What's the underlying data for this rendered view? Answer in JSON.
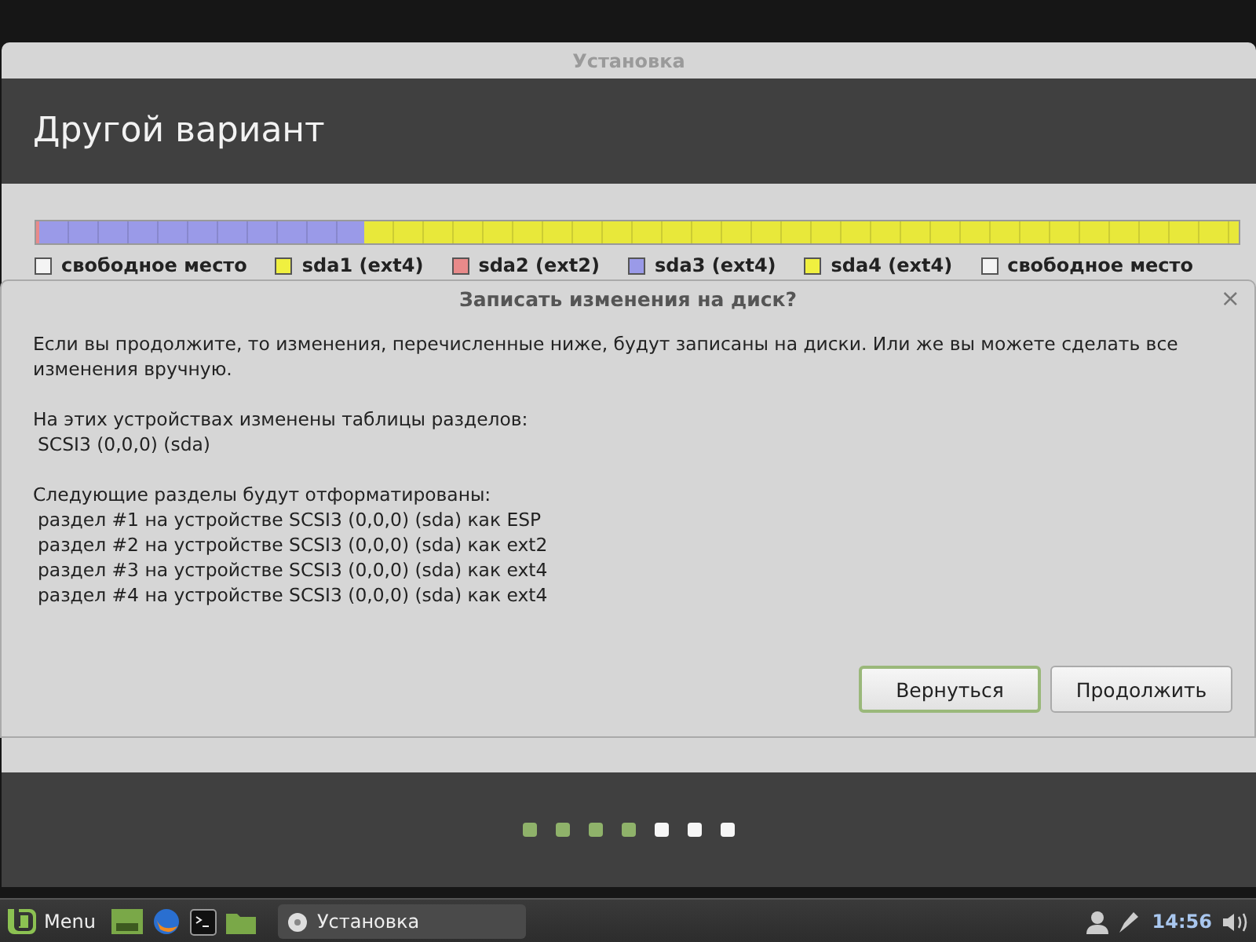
{
  "window": {
    "title": "Установка"
  },
  "header": {
    "title": "Другой вариант"
  },
  "partition_bar": {
    "segments": [
      {
        "color": "#e88a8a",
        "level": 0.003
      },
      {
        "color": "#9a9ae8",
        "level": 0.27
      },
      {
        "color": "#e8e83a",
        "level": 0.727
      }
    ]
  },
  "legend": [
    {
      "label": "свободное место",
      "color": "#f4f4f4"
    },
    {
      "label": "sda1 (ext4)",
      "color": "#f0f040"
    },
    {
      "label": "sda2 (ext2)",
      "color": "#e88a8a"
    },
    {
      "label": "sda3 (ext4)",
      "color": "#9a9ae8"
    },
    {
      "label": "sda4 (ext4)",
      "color": "#f0f040"
    },
    {
      "label": "свободное место",
      "color": "#f4f4f4"
    }
  ],
  "dialog": {
    "title": "Записать изменения на диск?",
    "close": "×",
    "message": "Если вы продолжите, то изменения, перечисленные ниже, будут записаны на диски. Или же вы можете сделать все изменения вручную.",
    "sections": [
      {
        "heading": "На этих устройствах изменены таблицы разделов:",
        "items": [
          "SCSI3 (0,0,0) (sda)"
        ]
      },
      {
        "heading": "Следующие разделы будут отформатированы:",
        "items": [
          "раздел #1 на устройстве SCSI3 (0,0,0) (sda) как ESP",
          "раздел #2 на устройстве SCSI3 (0,0,0) (sda) как ext2",
          "раздел #3 на устройстве SCSI3 (0,0,0) (sda) как ext4",
          "раздел #4 на устройстве SCSI3 (0,0,0) (sda) как ext4"
        ]
      }
    ],
    "buttons": [
      {
        "label": "Вернуться",
        "default": true
      },
      {
        "label": "Продолжить",
        "default": false
      }
    ]
  },
  "progress": [
    {
      "done": true
    },
    {
      "done": true
    },
    {
      "done": true
    },
    {
      "done": true
    },
    {
      "done": false
    },
    {
      "done": false
    },
    {
      "done": false
    }
  ],
  "taskbar": {
    "menu_label": "Menu",
    "window_button": "Установка",
    "clock": "14:56"
  }
}
